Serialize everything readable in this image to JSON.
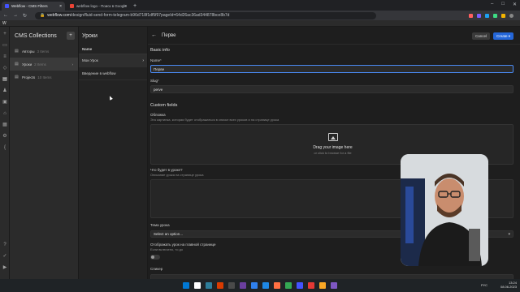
{
  "browser": {
    "tabs": [
      {
        "label": "Webflow - CMS Filters",
        "active": true,
        "favicon_color": "#4353ff"
      },
      {
        "label": "webflow logo - Поиск в Google",
        "active": false,
        "favicon_color": "#ea4335"
      }
    ],
    "new_tab_icon": "plus-icon",
    "url_host": "webflow.com",
    "url_path": "/design/fluid-send-form-telegram-b96d718f1df5f97pageId=64d26ac36ad344878bce8b7d",
    "window_controls": [
      "minimize-icon",
      "maximize-icon",
      "close-icon"
    ],
    "extension_colors": [
      "#ff5f5f",
      "#7a5cff",
      "#1da1f2",
      "#3ddc84",
      "#f4b400",
      "#888888"
    ]
  },
  "collections_panel": {
    "title": "CMS Collections",
    "add_icon": "add-collection-icon",
    "items": [
      {
        "label": "Авторы",
        "count": "3 Items",
        "active": false
      },
      {
        "label": "Уроки",
        "count": "2 Items",
        "active": true
      },
      {
        "label": "Projects",
        "count": "10 Items",
        "active": false
      }
    ]
  },
  "items_panel": {
    "title": "Уроки",
    "column_header": "Name",
    "rows": [
      {
        "label": "Мои Урок",
        "active": true
      },
      {
        "label": "Введение в webflow",
        "active": false
      }
    ]
  },
  "editor": {
    "title": "Перве",
    "cancel_label": "Cancel",
    "create_label": "Create",
    "basic_info_title": "Basic info",
    "name_label": "Name",
    "name_required": "*",
    "name_value": "Перве",
    "slug_label": "Slug",
    "slug_required": "*",
    "slug_value": "perve",
    "custom_fields_title": "Custom fields",
    "cover_label": "Обложка",
    "cover_hint": "Эта картинка, которая будет отображаться в списке всех уроков и на странице урока",
    "dropzone_title": "Drag your image here",
    "dropzone_sub": "or click to browse for a file",
    "learn_label": "Что будет в уроке?",
    "learn_hint": "Описание урока на странице урока",
    "topic_label": "Тема урока",
    "topic_value": "Select an option...",
    "show_label": "Отображать урок на главной странице",
    "show_hint": "Если включено, то до",
    "speaker_label": "Спикер"
  },
  "taskbar": {
    "icon_colors": [
      "#0078d4",
      "#ffffff",
      "#2d7d9a",
      "#d83b01",
      "#4a4a4a",
      "#6b3fa0",
      "#2f80ed",
      "#1e88e5",
      "#ff7043",
      "#34a853",
      "#4353ff",
      "#e53935",
      "#f9a825",
      "#7e57c2"
    ],
    "lang": "РУС",
    "time": "13:24",
    "date": "08.06.2023"
  },
  "accent": "#2466d8"
}
